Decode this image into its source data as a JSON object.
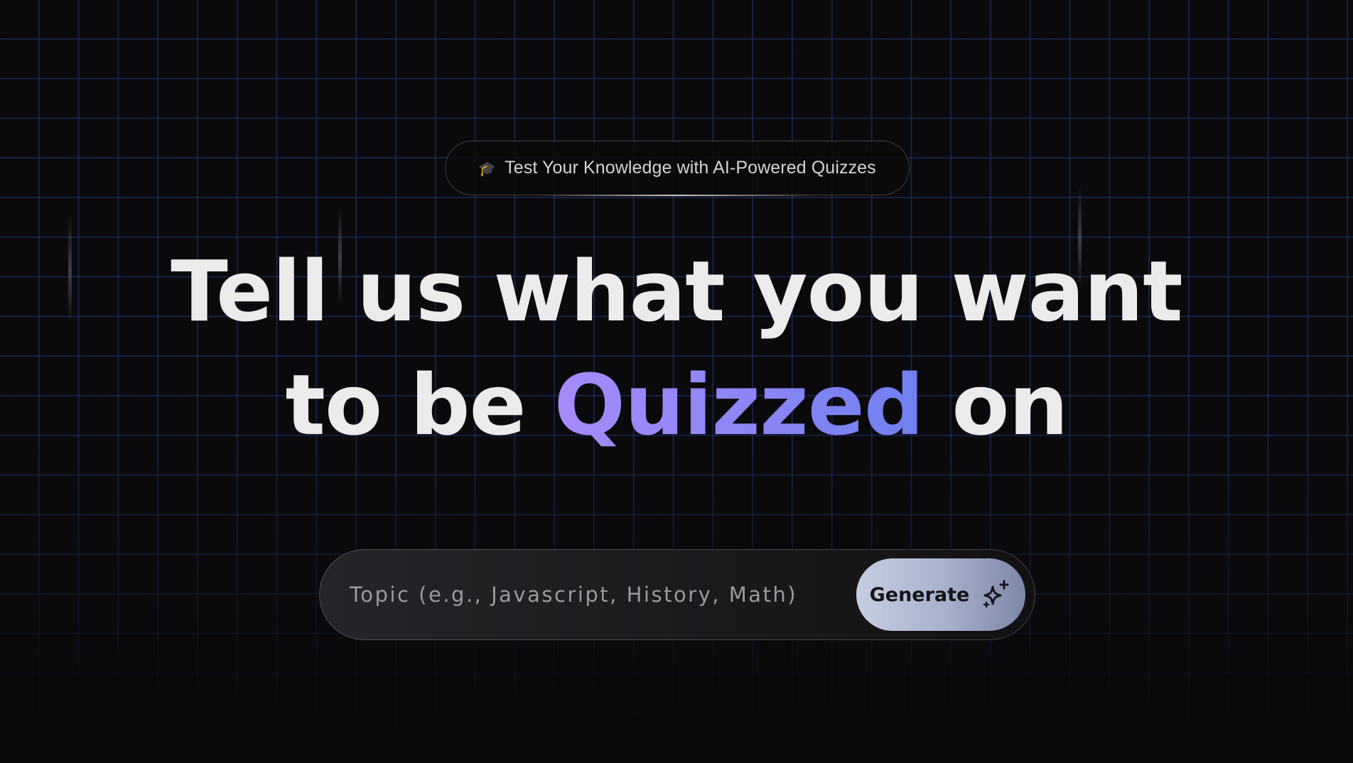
{
  "badge": {
    "icon": "graduation-cap-icon",
    "icon_glyph": "🎓",
    "text": "Test Your Knowledge with AI-Powered Quizzes"
  },
  "headline": {
    "line1": "Tell us what you want",
    "line2_prefix": "to be ",
    "highlight": "Quizzed",
    "line2_suffix": " on"
  },
  "search": {
    "placeholder": "Topic (e.g., Javascript, History, Math)",
    "value": ""
  },
  "generate_button": {
    "label": "Generate",
    "icon": "sparkle-icon"
  },
  "colors": {
    "background": "#0a0a0c",
    "grid_line": "#263478",
    "highlight_start": "#a78bfa",
    "highlight_end": "#6f7ff0",
    "button_start": "#c5cde0",
    "button_end": "#7d87a8"
  }
}
